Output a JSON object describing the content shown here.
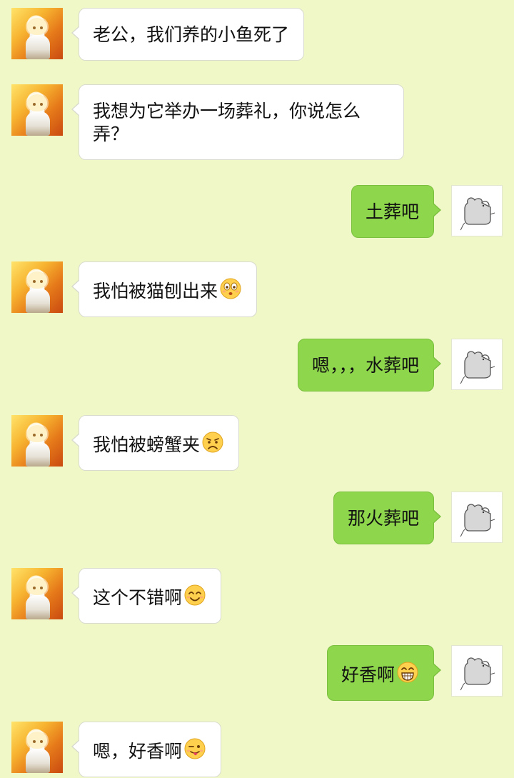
{
  "conversation": {
    "messages": [
      {
        "side": "left",
        "text": "老公，我们养的小鱼死了",
        "emoji": null
      },
      {
        "side": "left",
        "text": "我想为它举办一场葬礼，你说怎么弄？",
        "emoji": null
      },
      {
        "side": "right",
        "text": "土葬吧",
        "emoji": null
      },
      {
        "side": "left",
        "text": "我怕被猫刨出来",
        "emoji": "surprised-face-emoji"
      },
      {
        "side": "right",
        "text": "嗯，，，水葬吧",
        "emoji": null
      },
      {
        "side": "left",
        "text": "我怕被螃蟹夹",
        "emoji": "sad-face-emoji"
      },
      {
        "side": "right",
        "text": "那火葬吧",
        "emoji": null
      },
      {
        "side": "left",
        "text": "这个不错啊",
        "emoji": "smile-face-emoji"
      },
      {
        "side": "right",
        "text": "好香啊",
        "emoji": "grin-face-emoji"
      },
      {
        "side": "left",
        "text": "嗯，好香啊",
        "emoji": "wink-tongue-face-emoji"
      }
    ]
  },
  "colors": {
    "background": "#eff8c6",
    "incoming_bubble": "#ffffff",
    "outgoing_bubble": "#8ed64c"
  },
  "icons": {
    "incoming_avatar": "anime-girl-avatar",
    "outgoing_avatar": "mouse-sketch-avatar"
  }
}
